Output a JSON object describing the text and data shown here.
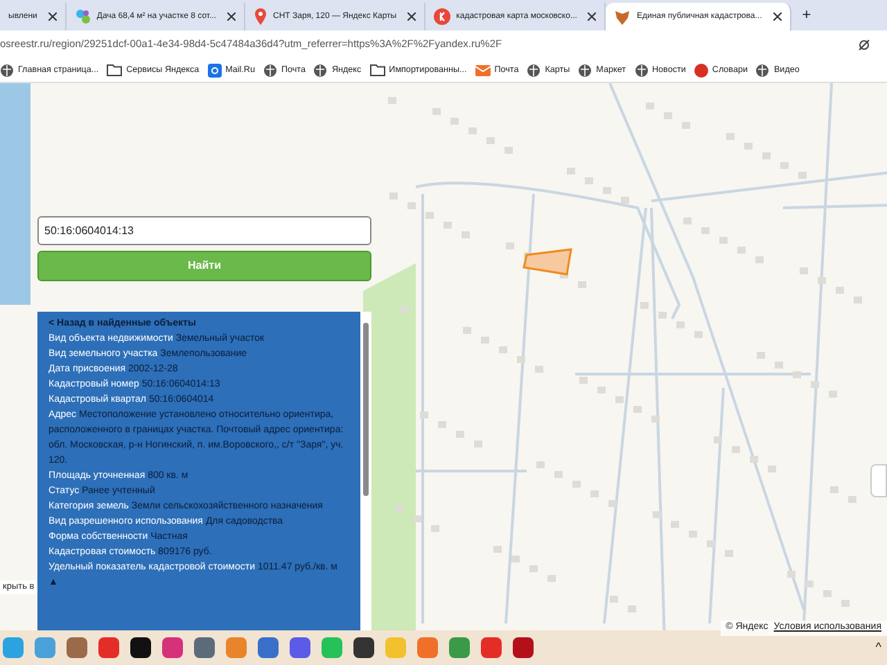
{
  "tabs": [
    {
      "title": "ывлени",
      "selected": false,
      "kind": "plain"
    },
    {
      "title": "Дача 68,4 м² на участке 8 сот...",
      "selected": false,
      "kind": "dots"
    },
    {
      "title": "СНТ Заря, 120 — Яндекс Карты",
      "selected": false,
      "kind": "pin"
    },
    {
      "title": "кадастровая карта московско...",
      "selected": false,
      "kind": "yandex"
    },
    {
      "title": "Единая публичная кадастрова...",
      "selected": true,
      "kind": "emblem"
    }
  ],
  "new_tab": "+",
  "address": "osreestr.ru/region/29251dcf-00a1-4e34-98d4-5c47484a36d4?utm_referrer=https%3A%2F%2Fyandex.ru%2F",
  "bookmarks": [
    {
      "label": "Главная страница...",
      "kind": "globe"
    },
    {
      "label": "Сервисы Яндекса",
      "kind": "folder"
    },
    {
      "label": "Mail.Ru",
      "kind": "mail"
    },
    {
      "label": "Почта",
      "kind": "globe"
    },
    {
      "label": "Яндекс",
      "kind": "globe"
    },
    {
      "label": "Импортированны...",
      "kind": "folder"
    },
    {
      "label": "Почта",
      "kind": "envelope"
    },
    {
      "label": "Карты",
      "kind": "globe"
    },
    {
      "label": "Маркет",
      "kind": "globe"
    },
    {
      "label": "Новости",
      "kind": "globe"
    },
    {
      "label": "Словари",
      "kind": "dict"
    },
    {
      "label": "Видео",
      "kind": "globe"
    }
  ],
  "search": {
    "value": "50:16:0604014:13",
    "button": "Найти"
  },
  "panel": {
    "back": "< Назад в найденные объекты",
    "rows": [
      {
        "label": "Вид объекта недвижимости",
        "value": "Земельный участок"
      },
      {
        "label": "Вид земельного участка",
        "value": "Землепользование"
      },
      {
        "label": "Дата присвоения",
        "value": "2002-12-28"
      },
      {
        "label": "Кадастровый номер",
        "value": "50:16:0604014:13"
      },
      {
        "label": "Кадастровый квартал",
        "value": "50:16:0604014"
      },
      {
        "label": "Адрес",
        "value": "Местоположение установлено относительно ориентира, расположенного в границах участка. Почтовый адрес ориентира: обл. Московская, р-н Ногинский, п. им.Воровского,, с/т \"Заря\", уч. 120."
      },
      {
        "label": "Площадь уточненная",
        "value": "800 кв. м"
      },
      {
        "label": "Статус",
        "value": "Ранее учтенный"
      },
      {
        "label": "Категория земель",
        "value": "Земли сельскохозяйственного назначения"
      },
      {
        "label": "Вид разрешенного использования",
        "value": "Для садоводства"
      },
      {
        "label": "Форма собственности",
        "value": "Частная"
      },
      {
        "label": "Кадастровая стоимость",
        "value": "809176 руб."
      },
      {
        "label": "Удельный показатель кадастровой стоимости",
        "value": "1011.47 руб./кв. м"
      }
    ],
    "collapse": "▲"
  },
  "open_in": "крыть в",
  "attribution": {
    "copyright": "© Яндекс",
    "link": "Условия использования"
  },
  "taskbar": [
    {
      "color": "#2aa3e0"
    },
    {
      "color": "#4aa0d8"
    },
    {
      "color": "#9a6a4a"
    },
    {
      "color": "#e52d27"
    },
    {
      "color": "#111111"
    },
    {
      "color": "#d6327a"
    },
    {
      "color": "#5c6b7a"
    },
    {
      "color": "#e8852a"
    },
    {
      "color": "#3a6fc9"
    },
    {
      "color": "#5b5be8"
    },
    {
      "color": "#25c25a"
    },
    {
      "color": "#333333"
    },
    {
      "color": "#f2c12e"
    },
    {
      "color": "#f0702a"
    },
    {
      "color": "#3a9a48"
    },
    {
      "color": "#e52d27"
    },
    {
      "color": "#b3101a"
    }
  ],
  "tray_caret": "^"
}
